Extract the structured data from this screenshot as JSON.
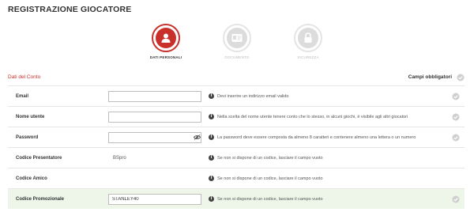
{
  "title": "REGISTRAZIONE GIOCATORE",
  "steps": [
    {
      "label": "DATI PERSONALI",
      "icon": "user-icon",
      "state": "active"
    },
    {
      "label": "DOCUMENTO",
      "icon": "id-card-icon",
      "state": "inactive"
    },
    {
      "label": "SICUREZZA",
      "icon": "lock-icon",
      "state": "inactive"
    }
  ],
  "section": {
    "title": "Dati del Conto",
    "required_label": "Campi obbligatori"
  },
  "rows": [
    {
      "label": "Email",
      "value": "",
      "help": "Devi inserire un indirizzo email valido"
    },
    {
      "label": "Nome utente",
      "value": "",
      "help": "Nella scelta del nome utente tenere conto che lo stesso, in alcuni giochi, è visibile agli altri giocatori"
    },
    {
      "label": "Password",
      "value": "",
      "help": "La password deve essere composta da almeno 8 caratteri e contenere almeno una lettera o un numero"
    },
    {
      "label": "Codice Presentatore",
      "value": "BSpro",
      "help": "Se non si dispone di un codice, lasciare il campo vuoto"
    },
    {
      "label": "Codice Amico",
      "value": "",
      "help": "Se non si dispone di un codice, lasciare il campo vuoto"
    },
    {
      "label": "Codice Promozionale",
      "value": "STANLEY40",
      "help": "Se non si dispone di un codice, lasciare il campo vuoto"
    }
  ],
  "colors": {
    "accent": "#c9302c",
    "success_bg": "#eef6ea",
    "check": "#cfcfcf"
  }
}
